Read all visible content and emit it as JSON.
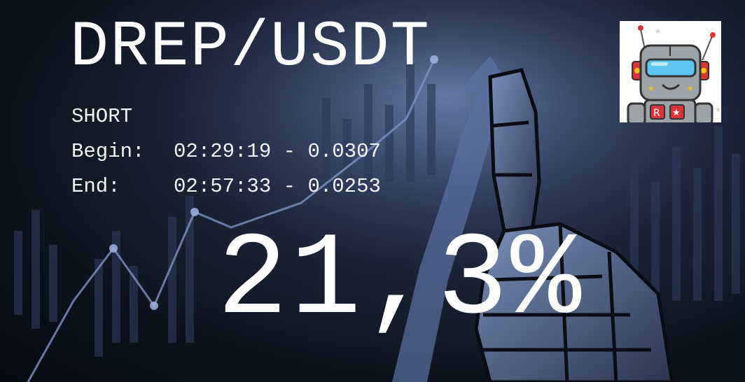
{
  "pair": "DREP/USDT",
  "side": "SHORT",
  "begin": {
    "label": "Begin:",
    "time": "02:29:19",
    "separator": "-",
    "price": "0.0307"
  },
  "end": {
    "label": "End:",
    "time": "02:57:33",
    "separator": "-",
    "price": "0.0253"
  },
  "result": "21,3%",
  "avatar": {
    "icon": "robot-mascot-icon",
    "badge_letter": "R"
  },
  "colors": {
    "text": "#ffffff",
    "background": "#0d121d",
    "accent": "#5c7bbd",
    "robot_red": "#d9343a",
    "robot_visor": "#5ec6f0"
  }
}
